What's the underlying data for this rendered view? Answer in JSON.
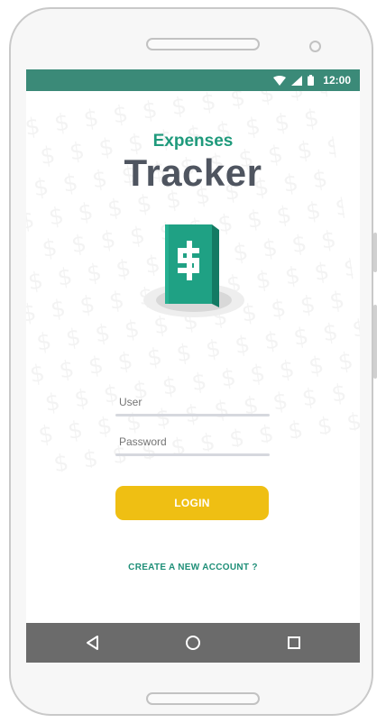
{
  "status_bar": {
    "time": "12:00",
    "icons": [
      "wifi-icon",
      "signal-icon",
      "battery-icon"
    ],
    "color": "#3b8a78"
  },
  "app": {
    "title_small": "Expenses",
    "title_large": "Tracker",
    "logo": "money-book-icon"
  },
  "form": {
    "user_placeholder": "User",
    "password_placeholder": "Password",
    "login_label": "LOGIN",
    "create_account_label": "CREATE A NEW ACCOUNT ?"
  },
  "nav_bar": {
    "buttons": [
      "back-icon",
      "home-icon",
      "recent-apps-icon"
    ]
  },
  "colors": {
    "accent": "#1f9a7c",
    "title": "#4f5560",
    "button": "#efbf13",
    "nav": "#6b6b6b"
  }
}
